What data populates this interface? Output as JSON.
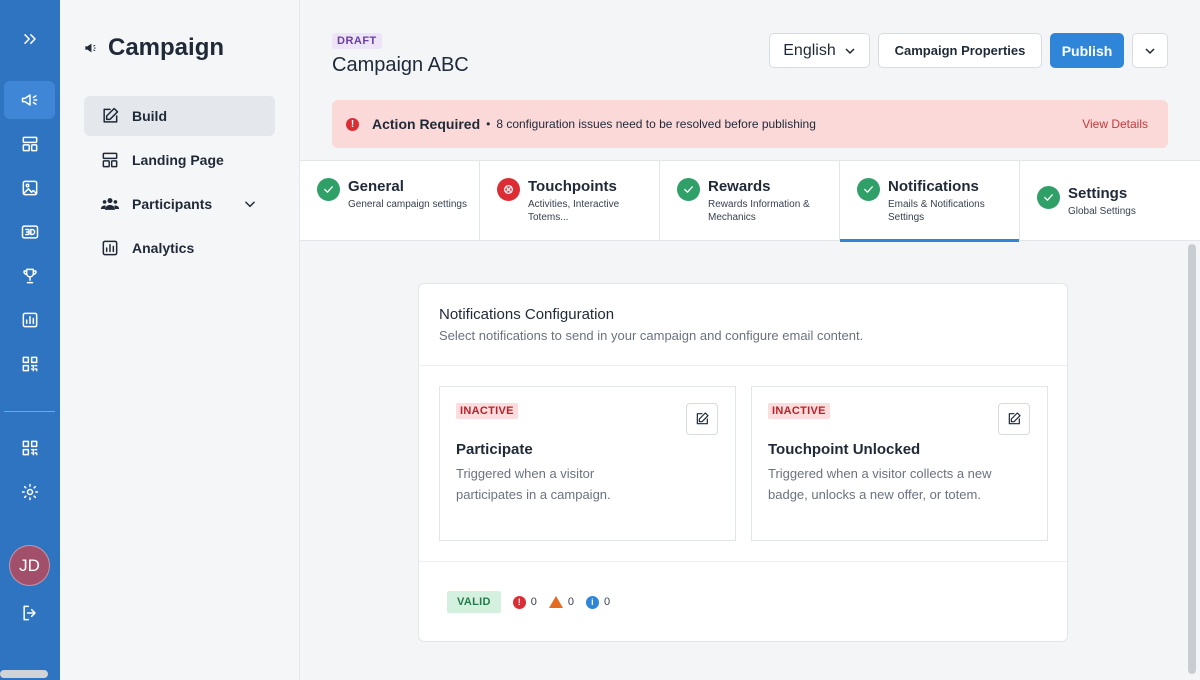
{
  "rail": {
    "avatar_initials": "JD",
    "icons": [
      "expand-icon",
      "campaign-icon",
      "layout-icon",
      "image-icon",
      "3d-icon",
      "trophy-icon",
      "chart-icon",
      "qr-icon",
      "qr-icon",
      "settings-icon",
      "logout-icon"
    ]
  },
  "nav": {
    "title": "Campaign",
    "items": [
      {
        "label": "Build",
        "active": true
      },
      {
        "label": "Landing Page"
      },
      {
        "label": "Participants"
      },
      {
        "label": "Analytics"
      }
    ]
  },
  "header": {
    "status_badge": "DRAFT",
    "campaign_name": "Campaign ABC",
    "language": "English",
    "properties_label": "Campaign Properties",
    "publish_label": "Publish"
  },
  "alert": {
    "title": "Action Required",
    "separator": "•",
    "message": "8 configuration issues need to be resolved before publishing",
    "link": "View Details"
  },
  "tabs": [
    {
      "label": "General",
      "sub": "General campaign settings",
      "status": "ok"
    },
    {
      "label": "Touchpoints",
      "sub": "Activities, Interactive Totems...",
      "status": "error"
    },
    {
      "label": "Rewards",
      "sub": "Rewards Information & Mechanics",
      "status": "ok"
    },
    {
      "label": "Notifications",
      "sub": "Emails & Notifications Settings",
      "status": "ok",
      "active": true
    },
    {
      "label": "Settings",
      "sub": "Global Settings",
      "status": "ok"
    }
  ],
  "card": {
    "title": "Notifications Configuration",
    "subtitle": "Select notifications to send in your campaign and configure email content.",
    "notifications": [
      {
        "status": "INACTIVE",
        "title": "Participate",
        "description": "Triggered when a visitor participates in a campaign."
      },
      {
        "status": "INACTIVE",
        "title": "Touchpoint Unlocked",
        "description": "Triggered when a visitor collects a new badge, unlocks a new offer, or totem."
      }
    ],
    "validation": {
      "badge": "VALID",
      "errors": "0",
      "warnings": "0",
      "info": "0"
    }
  },
  "colors": {
    "rail": "#2f74c0",
    "accent": "#2f86d9",
    "success": "#2fa067",
    "error": "#dc2d35",
    "warning": "#e56c1f"
  }
}
